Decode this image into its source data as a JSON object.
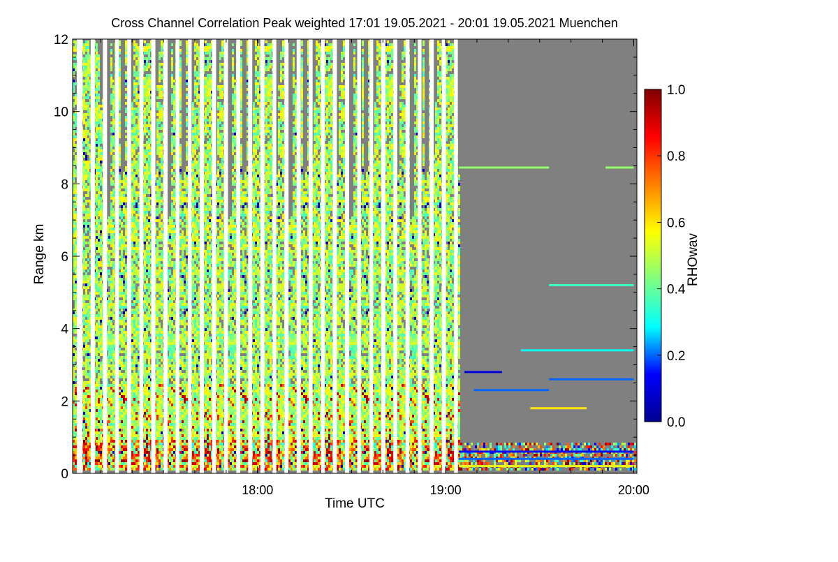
{
  "chart_data": {
    "type": "heatmap",
    "title": "Cross Channel Correlation Peak weighted   17:01 19.05.2021 - 20:01 19.05.2021 Muenchen",
    "xlabel": "Time UTC",
    "ylabel": "Range km",
    "x_range_utc": [
      "17:01",
      "20:01"
    ],
    "xlim_hours": [
      17.017,
      20.017
    ],
    "ylim_km": [
      0,
      12
    ],
    "x_ticks": [
      {
        "value": 18.0,
        "label": "18:00"
      },
      {
        "value": 19.0,
        "label": "19:00"
      },
      {
        "value": 20.0,
        "label": "20:00"
      }
    ],
    "y_ticks": [
      {
        "value": 0,
        "label": "0"
      },
      {
        "value": 2,
        "label": "2"
      },
      {
        "value": 4,
        "label": "4"
      },
      {
        "value": 6,
        "label": "6"
      },
      {
        "value": 8,
        "label": "8"
      },
      {
        "value": 10,
        "label": "10"
      },
      {
        "value": 12,
        "label": "12"
      }
    ],
    "colorbar": {
      "label": "RHOwav",
      "range": [
        0.0,
        1.0
      ],
      "ticks": [
        {
          "value": 0.0,
          "label": "0.0"
        },
        {
          "value": 0.2,
          "label": "0.2"
        },
        {
          "value": 0.4,
          "label": "0.4"
        },
        {
          "value": 0.6,
          "label": "0.6"
        },
        {
          "value": 0.8,
          "label": "0.8"
        },
        {
          "value": 1.0,
          "label": "1.0"
        }
      ],
      "colormap": [
        "#00008f",
        "#0000ff",
        "#00ffff",
        "#80ff80",
        "#ffff00",
        "#ff8000",
        "#ff0000",
        "#800000"
      ]
    },
    "colors": {
      "no_data": "#808080",
      "gap": "#ffffff"
    },
    "data_gaps_hours": [
      [
        17.04,
        17.07
      ],
      [
        17.113,
        17.135
      ],
      [
        17.178,
        17.2
      ],
      [
        17.243,
        17.263
      ],
      [
        17.307,
        17.328
      ],
      [
        17.372,
        17.393
      ],
      [
        17.435,
        17.457
      ],
      [
        17.5,
        17.522
      ],
      [
        17.565,
        17.585
      ],
      [
        17.63,
        17.65
      ],
      [
        17.693,
        17.715
      ],
      [
        17.758,
        17.78
      ],
      [
        17.822,
        17.843
      ],
      [
        17.887,
        17.908
      ],
      [
        17.95,
        17.972
      ],
      [
        18.015,
        18.037
      ],
      [
        18.08,
        18.1
      ],
      [
        18.143,
        18.165
      ],
      [
        18.208,
        18.23
      ],
      [
        18.272,
        18.293
      ],
      [
        18.337,
        18.358
      ],
      [
        18.4,
        18.422
      ],
      [
        18.465,
        18.487
      ],
      [
        18.53,
        18.55
      ],
      [
        18.595,
        18.615
      ],
      [
        18.658,
        18.68
      ],
      [
        18.722,
        18.743
      ],
      [
        18.787,
        18.808
      ],
      [
        18.852,
        18.872
      ],
      [
        18.915,
        18.937
      ],
      [
        18.98,
        19.002
      ],
      [
        19.045,
        19.065
      ]
    ],
    "coverage_top_km": 12.0,
    "coverage_top_km_after_19_07": 8.5,
    "layers_after_19_07": [
      {
        "range_km": 8.45,
        "start_hours": 19.07,
        "end_hours": 19.55,
        "value": 0.45
      },
      {
        "range_km": 8.45,
        "start_hours": 19.85,
        "end_hours": 20.0,
        "value": 0.45
      },
      {
        "range_km": 5.2,
        "start_hours": 19.55,
        "end_hours": 20.0,
        "value": 0.35
      },
      {
        "range_km": 3.4,
        "start_hours": 19.4,
        "end_hours": 20.0,
        "value": 0.3
      },
      {
        "range_km": 2.8,
        "start_hours": 19.1,
        "end_hours": 19.3,
        "value": 0.1
      },
      {
        "range_km": 2.6,
        "start_hours": 19.55,
        "end_hours": 20.0,
        "value": 0.2
      },
      {
        "range_km": 2.3,
        "start_hours": 19.15,
        "end_hours": 19.55,
        "value": 0.2
      },
      {
        "range_km": 1.8,
        "start_hours": 19.45,
        "end_hours": 19.75,
        "value": 0.6
      },
      {
        "range_km": 0.6,
        "start_hours": 19.07,
        "end_hours": 20.0,
        "value": 0.15
      },
      {
        "range_km": 0.4,
        "start_hours": 19.07,
        "end_hours": 20.0,
        "value": 0.2
      },
      {
        "range_km": 0.2,
        "start_hours": 19.07,
        "end_hours": 20.0,
        "value": 0.55
      }
    ]
  }
}
